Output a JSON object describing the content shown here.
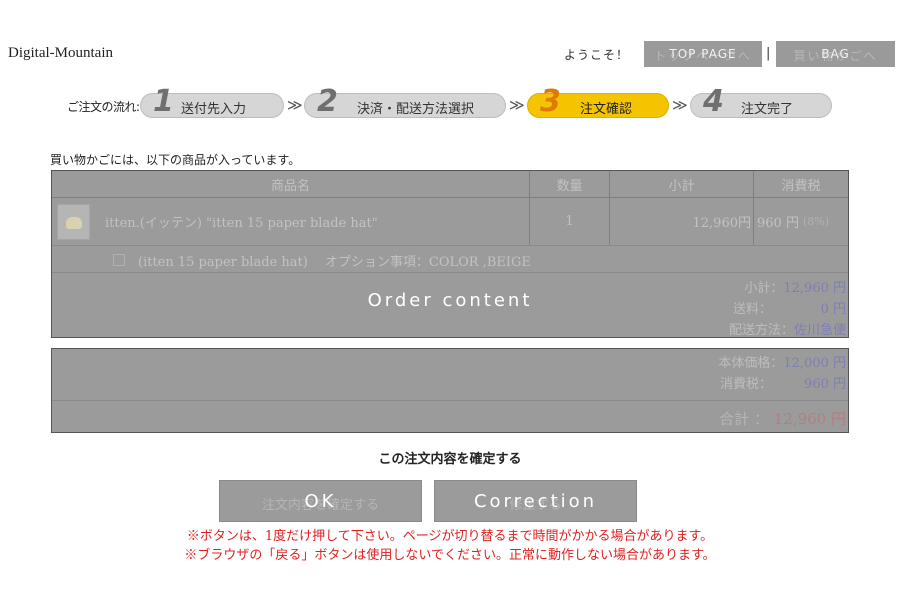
{
  "header": {
    "brand": "Digital-Mountain",
    "welcome": "ようこそ！",
    "top_button": {
      "label": "TOP PAGE",
      "underlying": "トップページへ"
    },
    "separator": "|",
    "bag_button": {
      "label": "BAG",
      "underlying": "買い物かごへ"
    }
  },
  "steps": {
    "label": "ご注文の流れ:",
    "items": [
      {
        "number": "1",
        "label": "送付先入力",
        "active": false
      },
      {
        "number": "2",
        "label": "決済・配送方法選択",
        "active": false
      },
      {
        "number": "3",
        "label": "注文確認",
        "active": true
      },
      {
        "number": "4",
        "label": "注文完了",
        "active": false
      }
    ],
    "arrow": "≫"
  },
  "intro": "買い物かごには、以下の商品が入っています。",
  "order": {
    "caption": "Order content",
    "columns": [
      "商品名",
      "数量",
      "小計",
      "消費税"
    ],
    "item": {
      "name": "itten.(イッテン) \"itten 15 paper blade hat\"",
      "quantity": "1",
      "subtotal": "12,960円",
      "tax": "960 円",
      "tax_rate": "(8%)",
      "option": "(itten 15 paper blade hat)　 オプション事項：COLOR ,BEIGE"
    },
    "summary": {
      "subtotal_label": "小計：",
      "subtotal_value": "12,960 円",
      "shipping_label": "送料：",
      "shipping_value": "0 円",
      "method_label": "配送方法：",
      "method_value": "佐川急便"
    }
  },
  "totals": {
    "price_label": "本体価格：",
    "price_value": "12,000 円",
    "tax_label": "消費税：",
    "tax_value": "960 円",
    "total_label": "合計 ：",
    "total_value": "12,960 円"
  },
  "confirm_title": "この注文内容を確定する",
  "buttons": {
    "ok_label": "OK",
    "ok_underlying": "注文内容を確定する",
    "correction_label": "Correction",
    "correction_underlying": "修正する"
  },
  "notes": [
    "※ボタンは、1度だけ押して下さい。ページが切り替るまで時間がかかる場合があります。",
    "※ブラウザの「戻る」ボタンは使用しないでください。正常に動作しない場合があります。"
  ],
  "colors": {
    "active_step": "#f4c400",
    "overlay_gray": "#9b9b9b",
    "notice_red": "#e02020"
  }
}
